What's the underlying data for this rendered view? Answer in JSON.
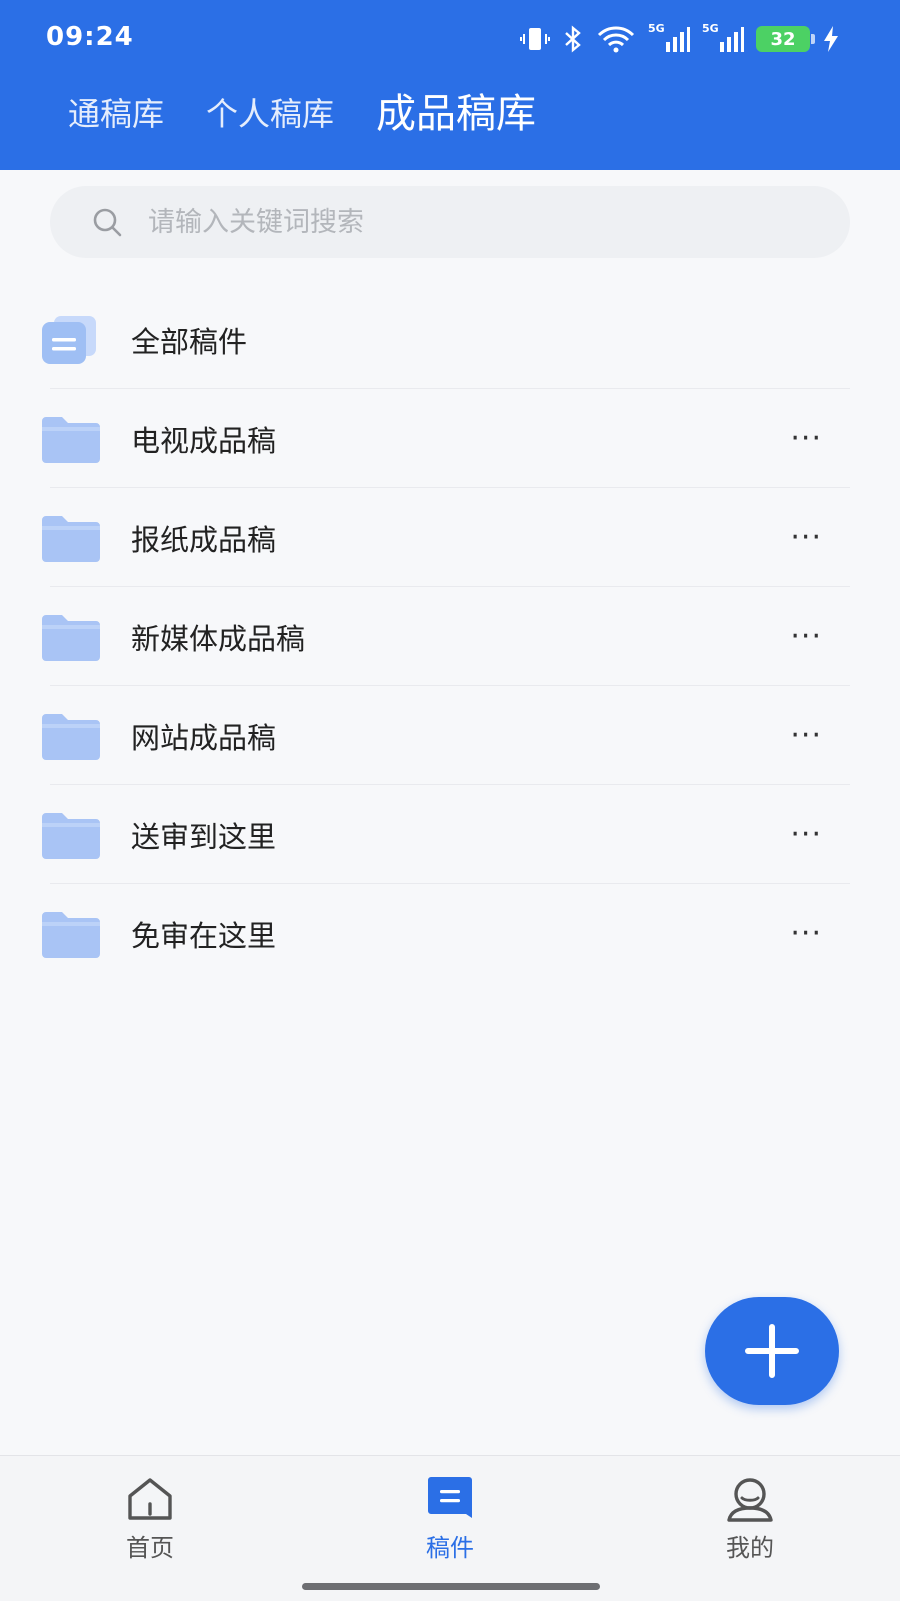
{
  "status_bar": {
    "time": "09:24",
    "battery": "32",
    "net1": "5G",
    "net2": "5G"
  },
  "tabs": [
    {
      "label": "通稿库",
      "active": false
    },
    {
      "label": "个人稿库",
      "active": false
    },
    {
      "label": "成品稿库",
      "active": true
    }
  ],
  "search": {
    "placeholder": "请输入关键词搜索",
    "value": ""
  },
  "folders": [
    {
      "label": "全部稿件",
      "icon": "stack-icon",
      "has_more": false
    },
    {
      "label": "电视成品稿",
      "icon": "folder-icon",
      "has_more": true
    },
    {
      "label": "报纸成品稿",
      "icon": "folder-icon",
      "has_more": true
    },
    {
      "label": "新媒体成品稿",
      "icon": "folder-icon",
      "has_more": true
    },
    {
      "label": "网站成品稿",
      "icon": "folder-icon",
      "has_more": true
    },
    {
      "label": "送审到这里",
      "icon": "folder-icon",
      "has_more": true
    },
    {
      "label": "免审在这里",
      "icon": "folder-icon",
      "has_more": true
    }
  ],
  "more_glyph": "···",
  "nav": [
    {
      "label": "首页",
      "icon": "home-icon",
      "active": false
    },
    {
      "label": "稿件",
      "icon": "document-icon",
      "active": true
    },
    {
      "label": "我的",
      "icon": "profile-icon",
      "active": false
    }
  ],
  "colors": {
    "primary": "#2b6fe6",
    "folder": "#a9c4f5",
    "battery": "#4cd164"
  }
}
